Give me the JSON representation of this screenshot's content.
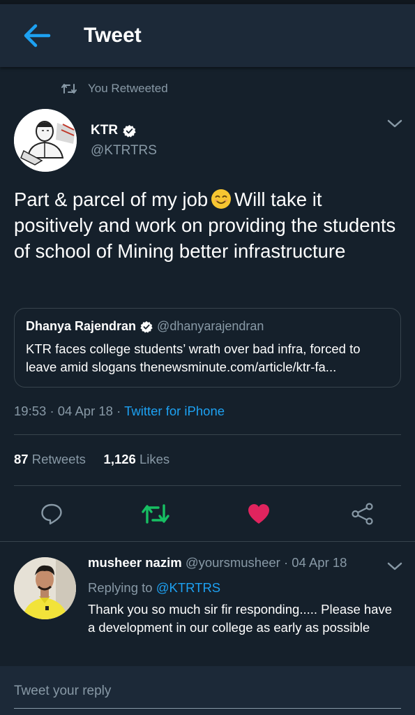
{
  "header": {
    "title": "Tweet",
    "icon": "arrow-left-icon"
  },
  "retweet_context": {
    "text": "You Retweeted",
    "icon": "retweet-icon"
  },
  "tweet": {
    "author": {
      "name": "KTR",
      "handle": "@KTRTRS",
      "verified": true
    },
    "text_part1": "Part & parcel of my job",
    "emoji": "smiling-face-icon",
    "text_part2": "Will take it positively and work on providing the students of school of Mining better infrastructure",
    "quote": {
      "name": "Dhanya Rajendran",
      "handle": "@dhanyarajendran",
      "text": "KTR faces college students’ wrath over bad infra, forced to leave amid slogans thenewsminute.com/article/ktr-fa..."
    },
    "time": "19:53",
    "separator": "·",
    "date": "04 Apr 18",
    "client": "Twitter for iPhone",
    "stats": {
      "retweets_count": "87",
      "retweets_label": "Retweets",
      "likes_count": "1,126",
      "likes_label": "Likes"
    }
  },
  "actions": {
    "reply_icon": "reply-icon",
    "retweet_icon": "retweet-icon",
    "like_icon": "heart-icon",
    "share_icon": "share-icon"
  },
  "reply": {
    "name": "musheer nazim",
    "handle": "@yoursmusheer",
    "date": "· 04 Apr 18",
    "replying_prefix": "Replying to",
    "replying_to": "@KTRTRS",
    "text": "Thank you so much sir fir responding..... Please have a development in our college as early as possible"
  },
  "compose": {
    "placeholder": "Tweet your reply"
  },
  "colors": {
    "background": "#15202b",
    "header": "#1c2938",
    "accent": "#1da1f2",
    "retweet_green": "#17bf63",
    "like_red": "#e0245e",
    "muted": "#8899a6"
  }
}
